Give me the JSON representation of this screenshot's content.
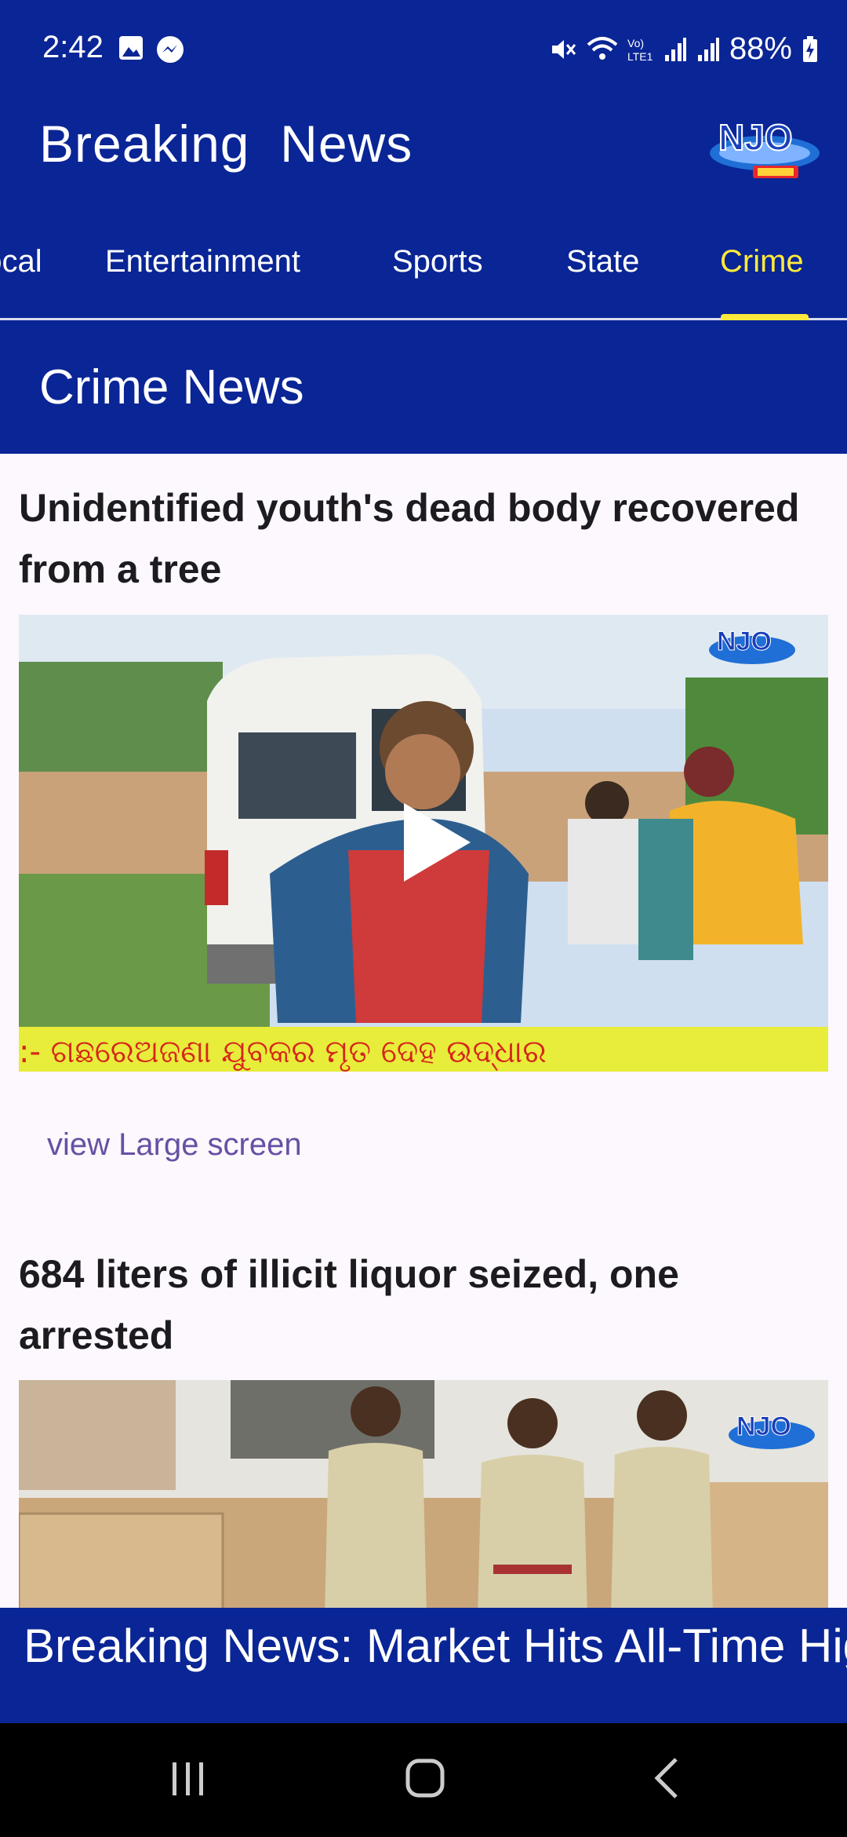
{
  "status": {
    "time": "2:42",
    "battery": "88%",
    "icons": [
      "image-icon",
      "messenger-icon",
      "mute-icon",
      "wifi-icon",
      "volte-icon",
      "signal-icon",
      "signal-icon",
      "battery-charging-icon"
    ]
  },
  "app_bar": {
    "title": "Breaking  News",
    "logo_text": "NJO"
  },
  "tabs": [
    {
      "label": "Local"
    },
    {
      "label": "Entertainment"
    },
    {
      "label": "Sports"
    },
    {
      "label": "State"
    },
    {
      "label": "Crime"
    }
  ],
  "active_tab": "Crime",
  "section": {
    "title": "Crime News"
  },
  "articles": [
    {
      "headline": "Unidentified youth's dead body recovered from a tree",
      "video_caption": ":- ଗଛରେଅଜଣା ଯୁବକର ମୃତ ଦେହ ଉଦ୍ଧାର",
      "link_label": "view Large screen"
    },
    {
      "headline": "684 liters of illicit liquor seized, one arrested"
    }
  ],
  "ticker": {
    "text": "Breaking News: Market Hits All-Time High"
  },
  "colors": {
    "primary": "#0a2595",
    "accent": "#ffea3b",
    "link": "#6750a4"
  }
}
